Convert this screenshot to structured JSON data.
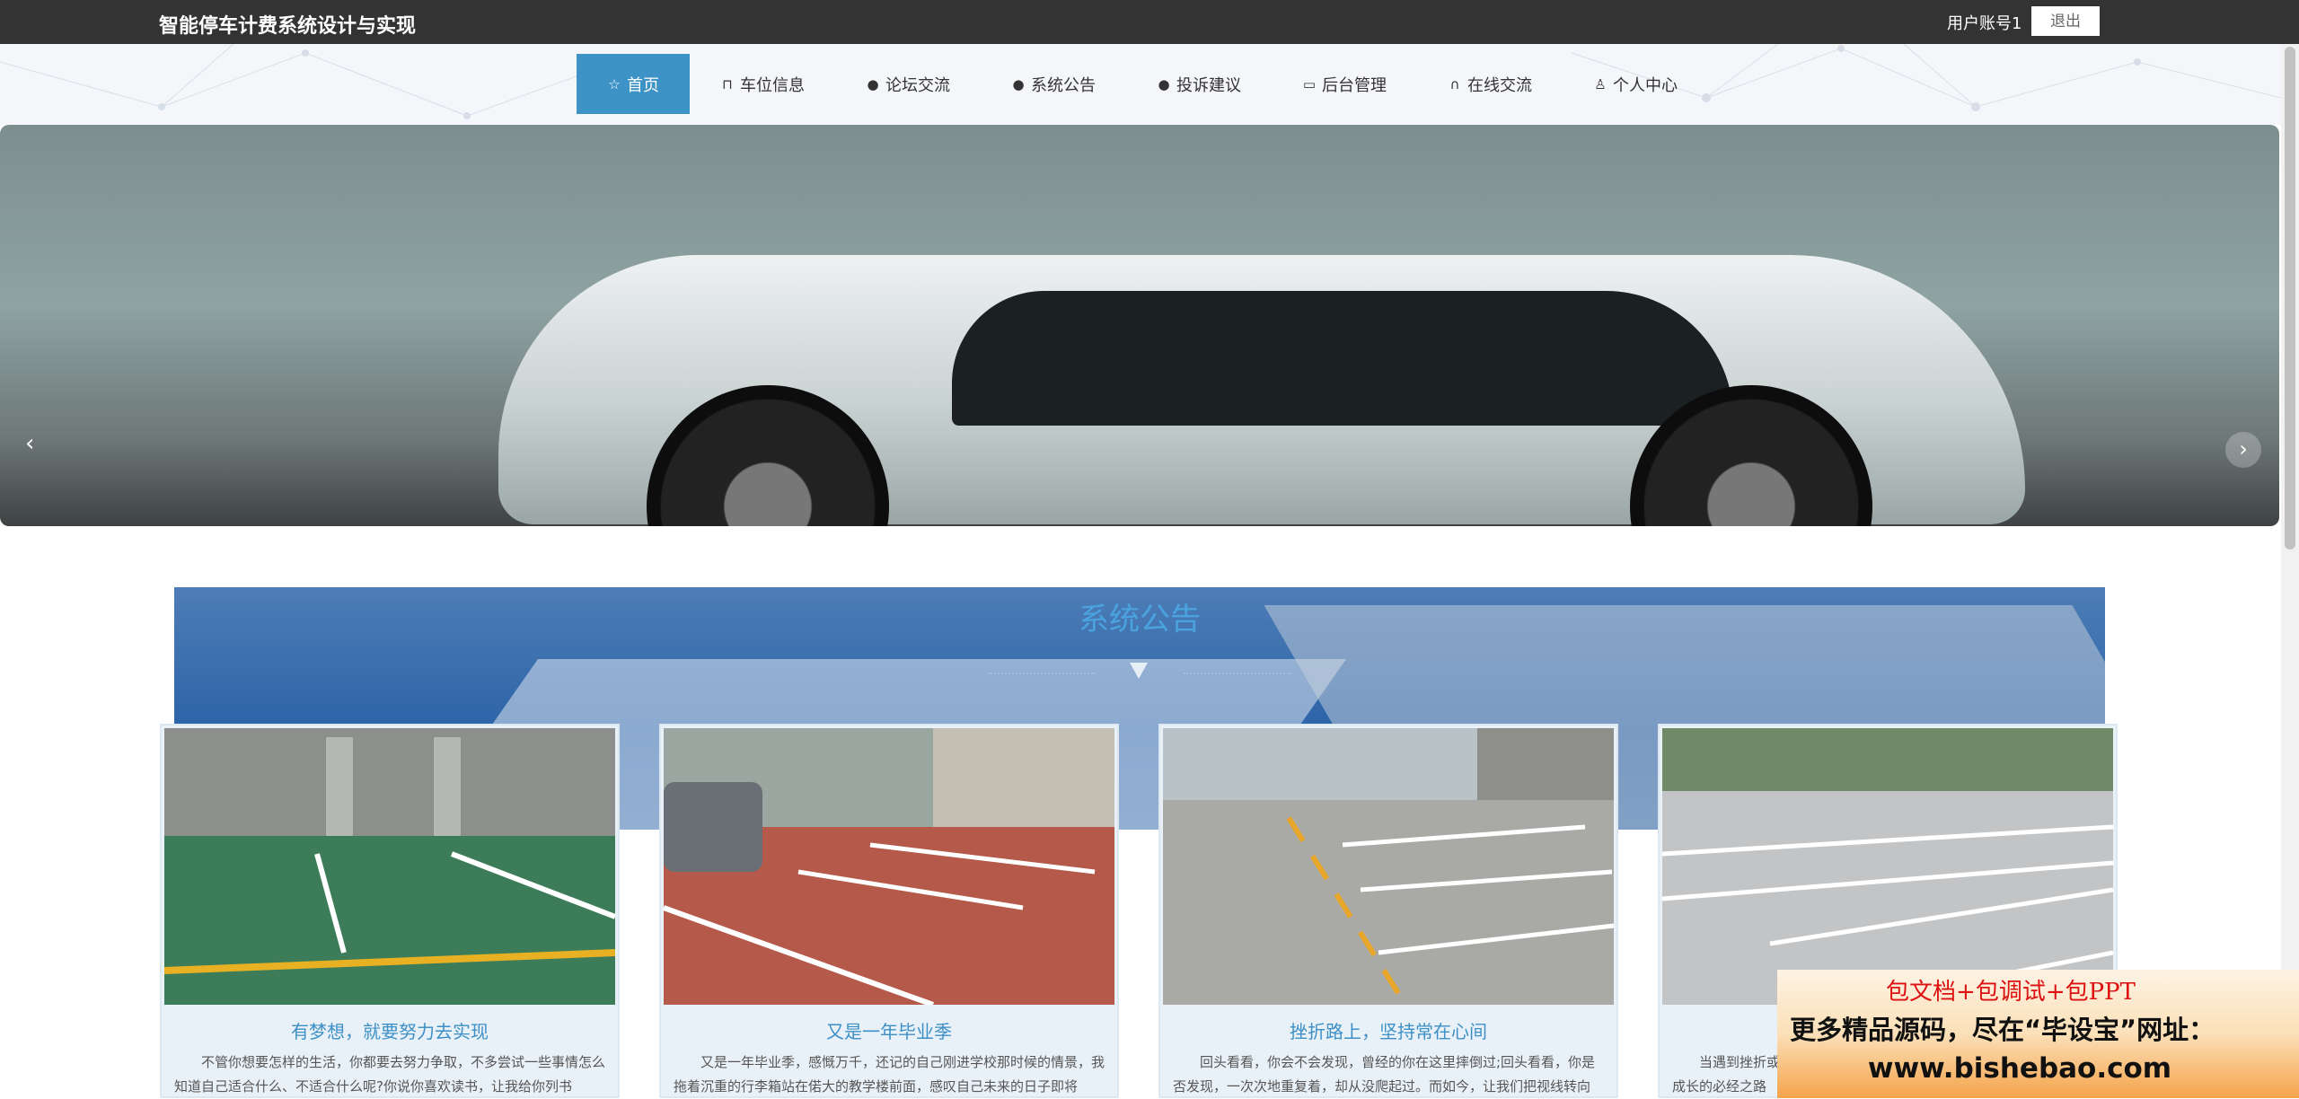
{
  "header": {
    "site_title": "智能停车计费系统设计与实现",
    "user_label": "用户账号1",
    "logout_label": "退出"
  },
  "nav": {
    "items": [
      {
        "label": "首页",
        "icon": "star-icon",
        "active": true
      },
      {
        "label": "车位信息",
        "icon": "bag-icon"
      },
      {
        "label": "论坛交流",
        "icon": "exclamation-circle-icon"
      },
      {
        "label": "系统公告",
        "icon": "question-circle-icon"
      },
      {
        "label": "投诉建议",
        "icon": "info-circle-icon"
      },
      {
        "label": "后台管理",
        "icon": "briefcase-icon"
      },
      {
        "label": "在线交流",
        "icon": "headset-icon"
      },
      {
        "label": "个人中心",
        "icon": "user-icon"
      }
    ]
  },
  "banner": {
    "prev_arrow": "‹",
    "next_arrow": "›",
    "slide_count": 3,
    "active_slide": 1
  },
  "notice_section": {
    "title": "系统公告",
    "cards": [
      {
        "title": "有梦想，就要努力去实现",
        "text": "不管你想要怎样的生活，你都要去努力争取，不多尝试一些事情怎么知道自己适合什么、不适合什么呢?你说你喜欢读书，让我给你列书"
      },
      {
        "title": "又是一年毕业季",
        "text": "又是一年毕业季，感慨万千，还记的自己刚进学校那时候的情景，我拖着沉重的行李箱站在偌大的教学楼前面，感叹自己未来的日子即将"
      },
      {
        "title": "挫折路上，坚持常在心间",
        "text": "回头看看，你会不会发现，曾经的你在这里摔倒过;回头看看，你是否发现，一次次地重复着，却从没爬起过。而如今，让我们把视线转向"
      },
      {
        "title": "",
        "text": "当遇到挫折或失败，你是看见失败还是看见机会?挫折是我们每个人成长的必经之路"
      }
    ]
  },
  "ad": {
    "line1": "包文档+包调试+包PPT",
    "line2": "更多精品源码，尽在“毕设宝”网址：",
    "line3": "www.bishebao.com"
  },
  "colors": {
    "topbar": "#333333",
    "nav_active": "#3d92c6",
    "title_blue": "#4aa3df",
    "card_title": "#3d8fc6"
  }
}
